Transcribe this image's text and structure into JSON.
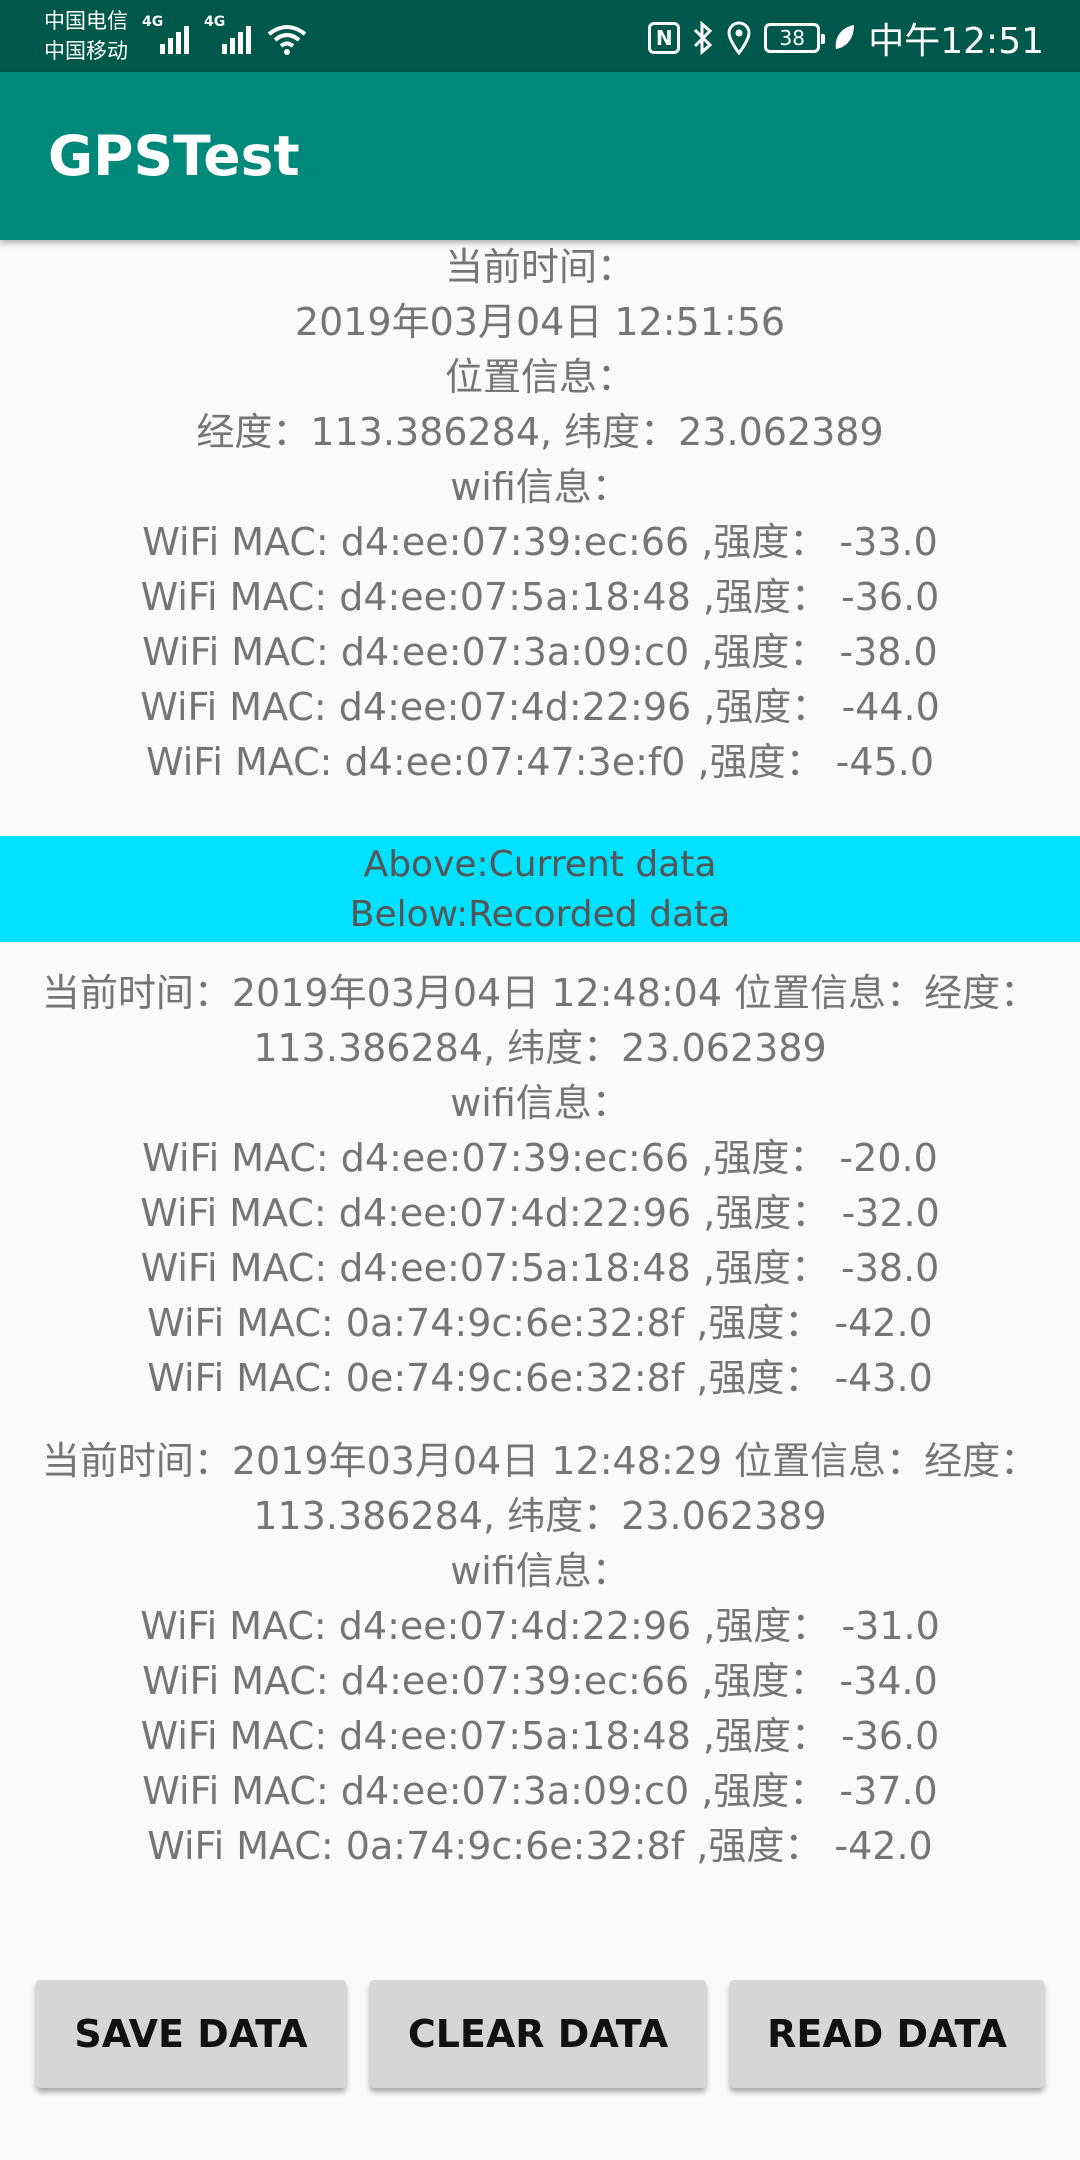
{
  "status_bar": {
    "carrier1": "中国电信",
    "carrier2": "中国移动",
    "network1": "4G",
    "network2": "4G",
    "nfc": "N",
    "battery": "38",
    "time": "中午12:51"
  },
  "appbar": {
    "title": "GPSTest"
  },
  "current": {
    "time_label": "当前时间：",
    "time_value": "2019年03月04日   12:51:56",
    "location_label": "位置信息：",
    "location_value": "经度：113.386284, 纬度：23.062389",
    "wifi_label": "wifi信息：",
    "wifi": [
      "WiFi MAC: d4:ee:07:39:ec:66 ,强度： -33.0",
      "WiFi MAC: d4:ee:07:5a:18:48 ,强度： -36.0",
      "WiFi MAC: d4:ee:07:3a:09:c0 ,强度： -38.0",
      "WiFi MAC: d4:ee:07:4d:22:96 ,强度： -44.0",
      "WiFi MAC: d4:ee:07:47:3e:f0 ,强度： -45.0"
    ]
  },
  "banner": {
    "line1": "Above:Current data",
    "line2": "Below:Recorded data"
  },
  "records": [
    {
      "header": "当前时间：2019年03月04日   12:48:04 位置信息：经度：113.386284, 纬度：23.062389",
      "wifi_label": "wifi信息：",
      "wifi": [
        "WiFi MAC: d4:ee:07:39:ec:66 ,强度： -20.0",
        "WiFi MAC: d4:ee:07:4d:22:96 ,强度： -32.0",
        "WiFi MAC: d4:ee:07:5a:18:48 ,强度： -38.0",
        "WiFi MAC: 0a:74:9c:6e:32:8f ,强度： -42.0",
        "WiFi MAC: 0e:74:9c:6e:32:8f ,强度： -43.0"
      ]
    },
    {
      "header": "当前时间：2019年03月04日   12:48:29 位置信息：经度：113.386284, 纬度：23.062389",
      "wifi_label": "wifi信息：",
      "wifi": [
        "WiFi MAC: d4:ee:07:4d:22:96 ,强度： -31.0",
        "WiFi MAC: d4:ee:07:39:ec:66 ,强度： -34.0",
        "WiFi MAC: d4:ee:07:5a:18:48 ,强度： -36.0",
        "WiFi MAC: d4:ee:07:3a:09:c0 ,强度： -37.0",
        "WiFi MAC: 0a:74:9c:6e:32:8f ,强度： -42.0"
      ]
    }
  ],
  "buttons": {
    "save": "SAVE DATA",
    "clear": "CLEAR DATA",
    "read": "READ DATA"
  }
}
